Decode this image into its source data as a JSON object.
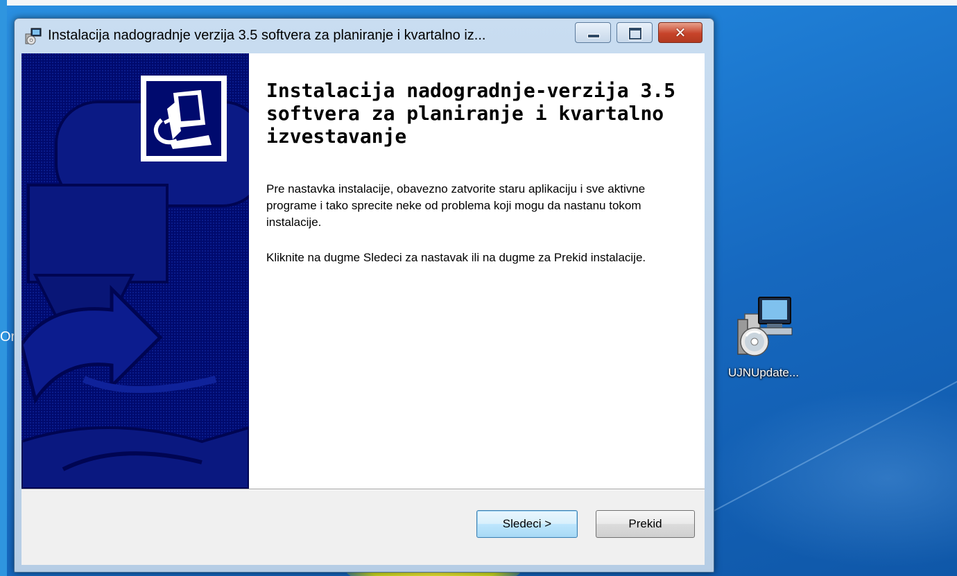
{
  "window": {
    "title": "Instalacija nadogradnje verzija 3.5 softvera za planiranje i kvartalno iz...",
    "close_glyph": "✕"
  },
  "installer": {
    "heading": "Instalacija nadogradnje-verzija 3.5 softvera za planiranje i kvartalno izvestavanje",
    "paragraph1": "Pre nastavka instalacije, obavezno zatvorite staru aplikaciju i sve aktivne programe i tako sprecite neke od problema koji mogu da nastanu tokom instalacije.",
    "paragraph2": "Kliknite na dugme Sledeci za nastavak ili na dugme za Prekid instalacije."
  },
  "buttons": {
    "next_label": "Sledeci >",
    "cancel_label": "Prekid"
  },
  "desktop": {
    "icon_label": "UJNUpdate...",
    "left_edge_text": "Or"
  },
  "colors": {
    "side_panel": "#000a6e",
    "desktop": "#1f7fd6"
  },
  "icons": {
    "title": "installer-app-icon",
    "side": "computer-installer-icon",
    "desktop": "setup-package-icon"
  }
}
